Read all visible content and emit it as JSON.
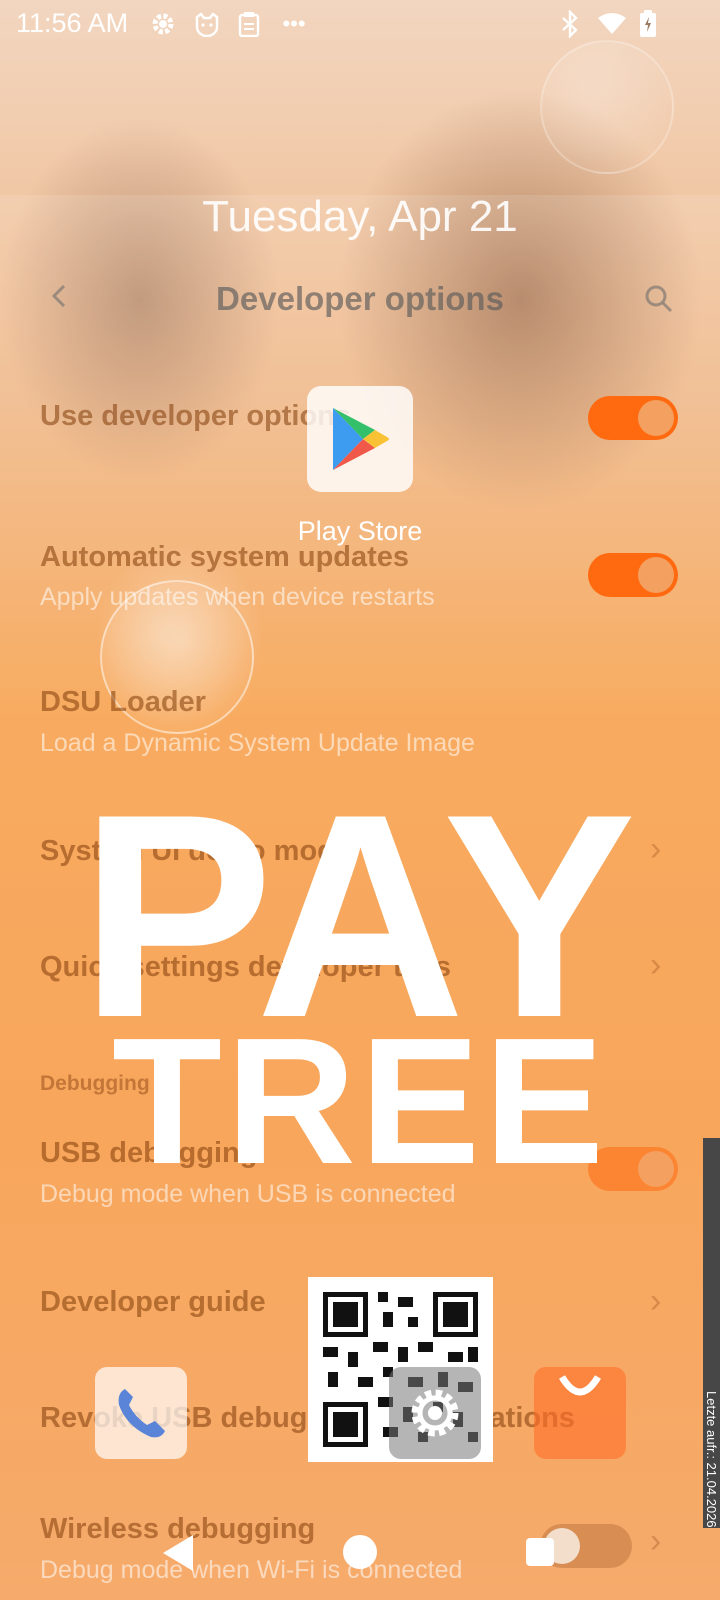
{
  "status_bar": {
    "time": "11:56 AM",
    "icons": [
      "settings-gear-icon",
      "cat-face-icon",
      "clipboard-icon",
      "more-dots-icon",
      "bluetooth-icon",
      "wifi-icon",
      "battery-charging-icon"
    ],
    "more_glyph": "•••"
  },
  "lock_date": "Tuesday, Apr 21",
  "settings": {
    "title": "Developer options",
    "rows": {
      "use_dev": {
        "title": "Use developer options",
        "on": true
      },
      "auto_updates": {
        "title": "Automatic system updates",
        "subtitle": "Apply updates when device restarts",
        "on": true
      },
      "dsu": {
        "title": "DSU Loader",
        "subtitle": "Load a Dynamic System Update Image"
      },
      "demo": {
        "title": "System UI demo mode"
      },
      "qs_tiles": {
        "title": "Quick settings developer tiles"
      },
      "section_debugging": "Debugging",
      "usb_debugging": {
        "title": "USB debugging",
        "subtitle": "Debug mode when USB is connected",
        "on": true
      },
      "dev_guide": {
        "title": "Developer guide"
      },
      "revoke": {
        "title": "Revoke USB debugging authorizations"
      },
      "wireless": {
        "title": "Wireless debugging",
        "subtitle": "Debug mode when Wi-Fi is connected",
        "on": false
      }
    },
    "chevron": "›"
  },
  "launcher": {
    "play_store_label": "Play Store",
    "logo_line1": "PAY",
    "logo_line2": "TREE",
    "side_tab_text": "Letzte aufr.: 21.04.2026",
    "dock": [
      "phone-icon",
      "qr-code",
      "settings-gear-icon",
      "shopping-bag-icon"
    ]
  },
  "colors": {
    "accent": "#ff6a10",
    "wallpaper_orange": "#f7a04a",
    "side_tab": "#474747"
  }
}
